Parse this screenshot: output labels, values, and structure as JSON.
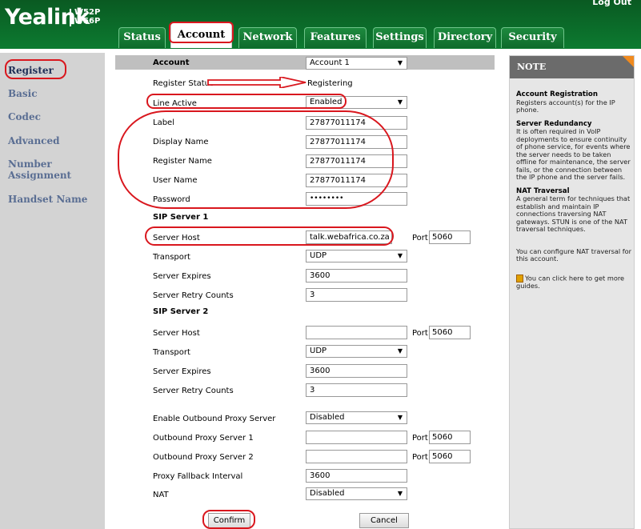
{
  "header": {
    "logo": "Yealink",
    "models": [
      "W52P",
      "W56P"
    ],
    "logout": "Log Out",
    "tabs": [
      "Status",
      "Account",
      "Network",
      "Features",
      "Settings",
      "Directory",
      "Security"
    ],
    "active_tab": "Account"
  },
  "sidebar": {
    "items": [
      "Register",
      "Basic",
      "Codec",
      "Advanced",
      "Number Assignment",
      "Handset Name"
    ],
    "active": "Register"
  },
  "form": {
    "account_label": "Account",
    "account_value": "Account 1",
    "register_status_label": "Register Status",
    "register_status_value": "Registering",
    "line_active_label": "Line Active",
    "line_active_value": "Enabled",
    "label_label": "Label",
    "label_value": "27877011174",
    "display_name_label": "Display Name",
    "display_name_value": "27877011174",
    "register_name_label": "Register Name",
    "register_name_value": "27877011174",
    "user_name_label": "User Name",
    "user_name_value": "27877011174",
    "password_label": "Password",
    "password_value": "••••••••",
    "sip1": {
      "title": "SIP Server 1",
      "server_host_label": "Server Host",
      "server_host_value": "talk.webafrica.co.za",
      "port_label": "Port",
      "port_value": "5060",
      "transport_label": "Transport",
      "transport_value": "UDP",
      "server_expires_label": "Server Expires",
      "server_expires_value": "3600",
      "retry_label": "Server Retry Counts",
      "retry_value": "3"
    },
    "sip2": {
      "title": "SIP Server 2",
      "server_host_label": "Server Host",
      "server_host_value": "",
      "port_label": "Port",
      "port_value": "5060",
      "transport_label": "Transport",
      "transport_value": "UDP",
      "server_expires_label": "Server Expires",
      "server_expires_value": "3600",
      "retry_label": "Server Retry Counts",
      "retry_value": "3"
    },
    "outbound_proxy_label": "Enable Outbound Proxy Server",
    "outbound_proxy_value": "Disabled",
    "proxy1_label": "Outbound Proxy Server 1",
    "proxy1_value": "",
    "proxy1_port_label": "Port",
    "proxy1_port": "5060",
    "proxy2_label": "Outbound Proxy Server 2",
    "proxy2_value": "",
    "proxy2_port_label": "Port",
    "proxy2_port": "5060",
    "fallback_label": "Proxy Fallback Interval",
    "fallback_value": "3600",
    "nat_label": "NAT",
    "nat_value": "Disabled",
    "confirm": "Confirm",
    "cancel": "Cancel"
  },
  "note": {
    "title": "NOTE",
    "sections": [
      {
        "heading": "Account Registration",
        "text": "Registers account(s) for the IP phone."
      },
      {
        "heading": "Server Redundancy",
        "text": "It is often required in VoIP deployments to ensure continuity of phone service, for events where the server needs to be taken offline for maintenance, the server fails, or the connection between the IP phone and the server fails."
      },
      {
        "heading": "NAT Traversal",
        "text": "A general term for techniques that establish and maintain IP connections traversing NAT gateways. STUN is one of the NAT traversal techniques."
      }
    ],
    "nat_config": "You can configure NAT traversal for this account.",
    "guide": "You can click here to get more guides."
  },
  "colors": {
    "header_green": "#0c7a30",
    "annotation_red": "#d9171e",
    "sidebar_bg": "#d3d3d3",
    "sidebar_text": "#5a6e93"
  }
}
